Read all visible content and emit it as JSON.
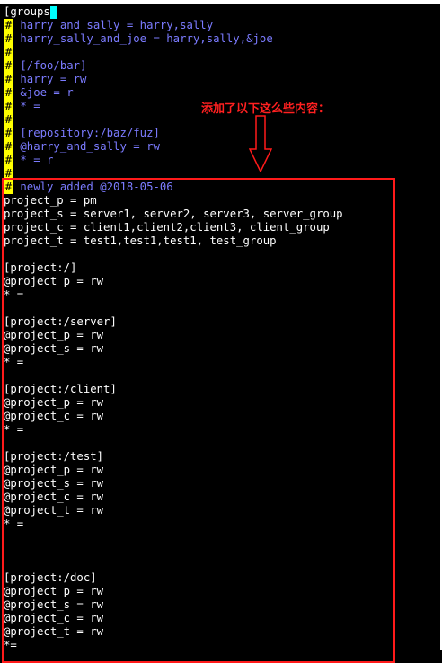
{
  "editor": {
    "lines": [
      {
        "kind": "plain",
        "hash": false,
        "text": "[groups",
        "cursor": true
      },
      {
        "kind": "comment",
        "hash": true,
        "text": " harry_and_sally = harry,sally"
      },
      {
        "kind": "comment",
        "hash": true,
        "text": " harry_sally_and_joe = harry,sally,&joe"
      },
      {
        "kind": "comment",
        "hash": true,
        "text": ""
      },
      {
        "kind": "comment",
        "hash": true,
        "text": " [/foo/bar]"
      },
      {
        "kind": "comment",
        "hash": true,
        "text": " harry = rw"
      },
      {
        "kind": "comment",
        "hash": true,
        "text": " &joe = r"
      },
      {
        "kind": "comment",
        "hash": true,
        "text": " * ="
      },
      {
        "kind": "comment",
        "hash": true,
        "text": ""
      },
      {
        "kind": "comment",
        "hash": true,
        "text": " [repository:/baz/fuz]"
      },
      {
        "kind": "comment",
        "hash": true,
        "text": " @harry_and_sally = rw"
      },
      {
        "kind": "comment",
        "hash": true,
        "text": " * = r"
      },
      {
        "kind": "comment",
        "hash": true,
        "text": ""
      },
      {
        "kind": "comment",
        "hash": true,
        "text": " newly added @2018-05-06"
      },
      {
        "kind": "plain",
        "hash": false,
        "text": "project_p = pm"
      },
      {
        "kind": "plain",
        "hash": false,
        "text": "project_s = server1, server2, server3, server_group"
      },
      {
        "kind": "plain",
        "hash": false,
        "text": "project_c = client1,client2,client3, client_group"
      },
      {
        "kind": "plain",
        "hash": false,
        "text": "project_t = test1,test1,test1, test_group"
      },
      {
        "kind": "plain",
        "hash": false,
        "text": ""
      },
      {
        "kind": "plain",
        "hash": false,
        "text": "[project:/]"
      },
      {
        "kind": "plain",
        "hash": false,
        "text": "@project_p = rw"
      },
      {
        "kind": "plain",
        "hash": false,
        "text": "* ="
      },
      {
        "kind": "plain",
        "hash": false,
        "text": ""
      },
      {
        "kind": "plain",
        "hash": false,
        "text": "[project:/server]"
      },
      {
        "kind": "plain",
        "hash": false,
        "text": "@project_p = rw"
      },
      {
        "kind": "plain",
        "hash": false,
        "text": "@project_s = rw"
      },
      {
        "kind": "plain",
        "hash": false,
        "text": "* ="
      },
      {
        "kind": "plain",
        "hash": false,
        "text": ""
      },
      {
        "kind": "plain",
        "hash": false,
        "text": "[project:/client]"
      },
      {
        "kind": "plain",
        "hash": false,
        "text": "@project_p = rw"
      },
      {
        "kind": "plain",
        "hash": false,
        "text": "@project_c = rw"
      },
      {
        "kind": "plain",
        "hash": false,
        "text": "* ="
      },
      {
        "kind": "plain",
        "hash": false,
        "text": ""
      },
      {
        "kind": "plain",
        "hash": false,
        "text": "[project:/test]"
      },
      {
        "kind": "plain",
        "hash": false,
        "text": "@project_p = rw"
      },
      {
        "kind": "plain",
        "hash": false,
        "text": "@project_s = rw"
      },
      {
        "kind": "plain",
        "hash": false,
        "text": "@project_c = rw"
      },
      {
        "kind": "plain",
        "hash": false,
        "text": "@project_t = rw"
      },
      {
        "kind": "plain",
        "hash": false,
        "text": "* ="
      },
      {
        "kind": "plain",
        "hash": false,
        "text": ""
      },
      {
        "kind": "plain",
        "hash": false,
        "text": ""
      },
      {
        "kind": "plain",
        "hash": false,
        "text": ""
      },
      {
        "kind": "plain",
        "hash": false,
        "text": "[project:/doc]"
      },
      {
        "kind": "plain",
        "hash": false,
        "text": "@project_p = rw"
      },
      {
        "kind": "plain",
        "hash": false,
        "text": "@project_s = rw"
      },
      {
        "kind": "plain",
        "hash": false,
        "text": "@project_c = rw"
      },
      {
        "kind": "plain",
        "hash": false,
        "text": "@project_t = rw"
      },
      {
        "kind": "plain",
        "hash": false,
        "text": "*="
      }
    ],
    "hash_char": "#"
  },
  "annotation": {
    "text": "添加了以下这么些内容：",
    "color": "#ff2020"
  },
  "colors": {
    "background": "#000000",
    "comment": "#7b7bff",
    "hash_bg": "#ffff00",
    "cursor": "#00ffff",
    "highlight_border": "#ff1a1a"
  },
  "icons": {
    "arrow": "down-arrow-icon"
  }
}
